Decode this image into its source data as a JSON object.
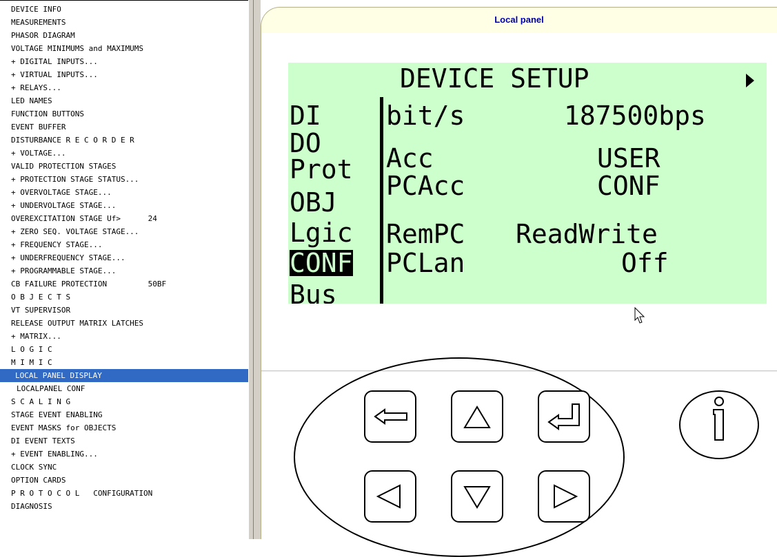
{
  "tree": {
    "items": [
      {
        "label": "DEVICE INFO"
      },
      {
        "label": "MEASUREMENTS"
      },
      {
        "label": "PHASOR DIAGRAM"
      },
      {
        "label": "VOLTAGE MINIMUMS and MAXIMUMS"
      },
      {
        "label": "+ DIGITAL INPUTS..."
      },
      {
        "label": "+ VIRTUAL INPUTS..."
      },
      {
        "label": "+ RELAYS..."
      },
      {
        "label": "LED NAMES"
      },
      {
        "label": "FUNCTION BUTTONS"
      },
      {
        "label": "EVENT BUFFER"
      },
      {
        "label": "DISTURBANCE R E C O R D E R"
      },
      {
        "label": "+ VOLTAGE..."
      },
      {
        "label": "VALID PROTECTION STAGES"
      },
      {
        "label": "+ PROTECTION STAGE STATUS..."
      },
      {
        "label": "+ OVERVOLTAGE STAGE..."
      },
      {
        "label": "+ UNDERVOLTAGE STAGE..."
      },
      {
        "label": "OVEREXCITATION STAGE Uf>      24"
      },
      {
        "label": "+ ZERO SEQ. VOLTAGE STAGE..."
      },
      {
        "label": "+ FREQUENCY STAGE..."
      },
      {
        "label": "+ UNDERFREQUENCY STAGE..."
      },
      {
        "label": "+ PROGRAMMABLE STAGE..."
      },
      {
        "label": "CB FAILURE PROTECTION         50BF"
      },
      {
        "label": "O B J E C T S"
      },
      {
        "label": "VT SUPERVISOR"
      },
      {
        "label": "RELEASE OUTPUT MATRIX LATCHES"
      },
      {
        "label": "+ MATRIX..."
      },
      {
        "label": "L O G I C"
      },
      {
        "label": "M I M I C"
      },
      {
        "label": "LOCAL PANEL DISPLAY"
      },
      {
        "label": "LOCALPANEL CONF"
      },
      {
        "label": "S C A L I N G"
      },
      {
        "label": "STAGE EVENT ENABLING"
      },
      {
        "label": "EVENT MASKS for OBJECTS"
      },
      {
        "label": "DI EVENT TEXTS"
      },
      {
        "label": "+ EVENT ENABLING..."
      },
      {
        "label": "CLOCK SYNC"
      },
      {
        "label": "OPTION CARDS"
      },
      {
        "label": "P R O T O C O L   CONFIGURATION"
      },
      {
        "label": "DIAGNOSIS"
      }
    ],
    "selected": "LOCAL PANEL DISPLAY"
  },
  "panel": {
    "title": "Local panel"
  },
  "lcd": {
    "title": "DEVICE SETUP",
    "menu": [
      "DI",
      "DO",
      "Prot",
      "OBJ",
      "Lgic",
      "CONF",
      "Bus"
    ],
    "active_menu": "CONF",
    "rows": [
      {
        "label": "bit/s",
        "value": "187500bps"
      },
      {
        "label": "Acc",
        "value": "USER"
      },
      {
        "label": "PCAcc",
        "value": "CONF"
      },
      {
        "label": "RemPC",
        "value": "ReadWrite"
      },
      {
        "label": "PCLan",
        "value": "Off"
      }
    ],
    "colors": {
      "background": "#ccffcc",
      "text": "#000000"
    }
  },
  "keypad": {
    "keys": [
      "back-arrow-icon",
      "up-triangle-icon",
      "enter-arrow-icon",
      "left-triangle-icon",
      "down-triangle-icon",
      "right-triangle-icon"
    ],
    "info_key": "info-icon"
  },
  "colors": {
    "selection": "#316ac5",
    "title_text": "#0000aa",
    "titlebar_bg": "#ffffe6",
    "frame": "#d4d0c8"
  }
}
